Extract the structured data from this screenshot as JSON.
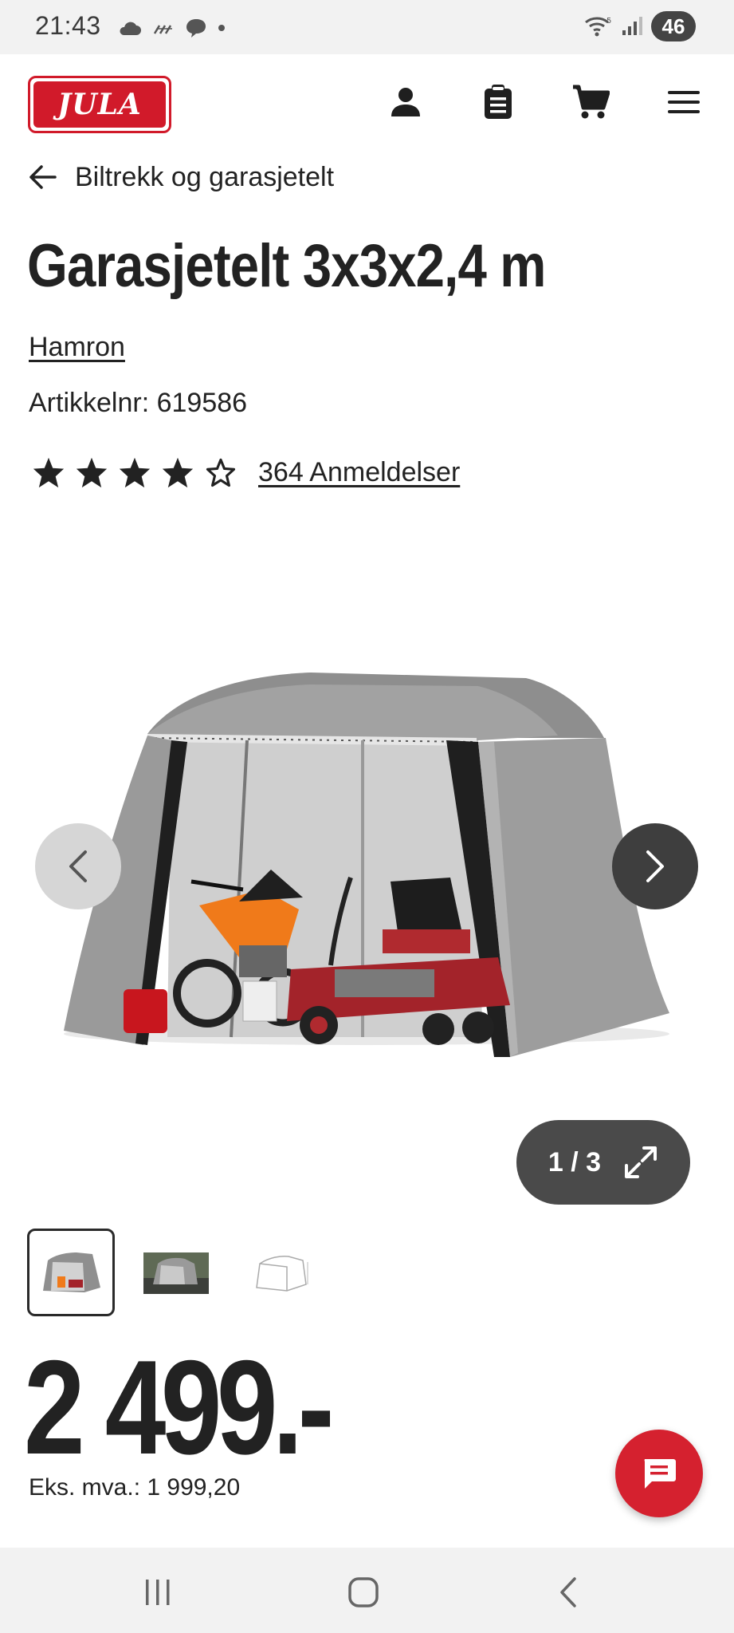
{
  "status_bar": {
    "time": "21:43",
    "battery": "46",
    "icons": [
      "cloud-icon",
      "rain-icon",
      "chat-bubble-icon",
      "dot-icon",
      "wifi-icon",
      "signal-icon"
    ]
  },
  "header": {
    "logo_text": "JULA",
    "icons": [
      "account-icon",
      "list-icon",
      "cart-icon",
      "menu-icon"
    ]
  },
  "breadcrumb": {
    "label": "Biltrekk og garasjetelt"
  },
  "product": {
    "title": "Garasjetelt 3x3x2,4 m",
    "brand": "Hamron",
    "sku": "Artikkelnr: 619586",
    "rating": 4,
    "rating_max": 5,
    "reviews": "364 Anmeldelser"
  },
  "gallery": {
    "counter": "1 / 3",
    "thumbnails": 3
  },
  "price": {
    "main": "2 499.-",
    "vat": "Eks. mva.: 1 999,20"
  },
  "colors": {
    "brand_red": "#d11a2a",
    "chat_red": "#d5212f",
    "text": "#222222"
  }
}
